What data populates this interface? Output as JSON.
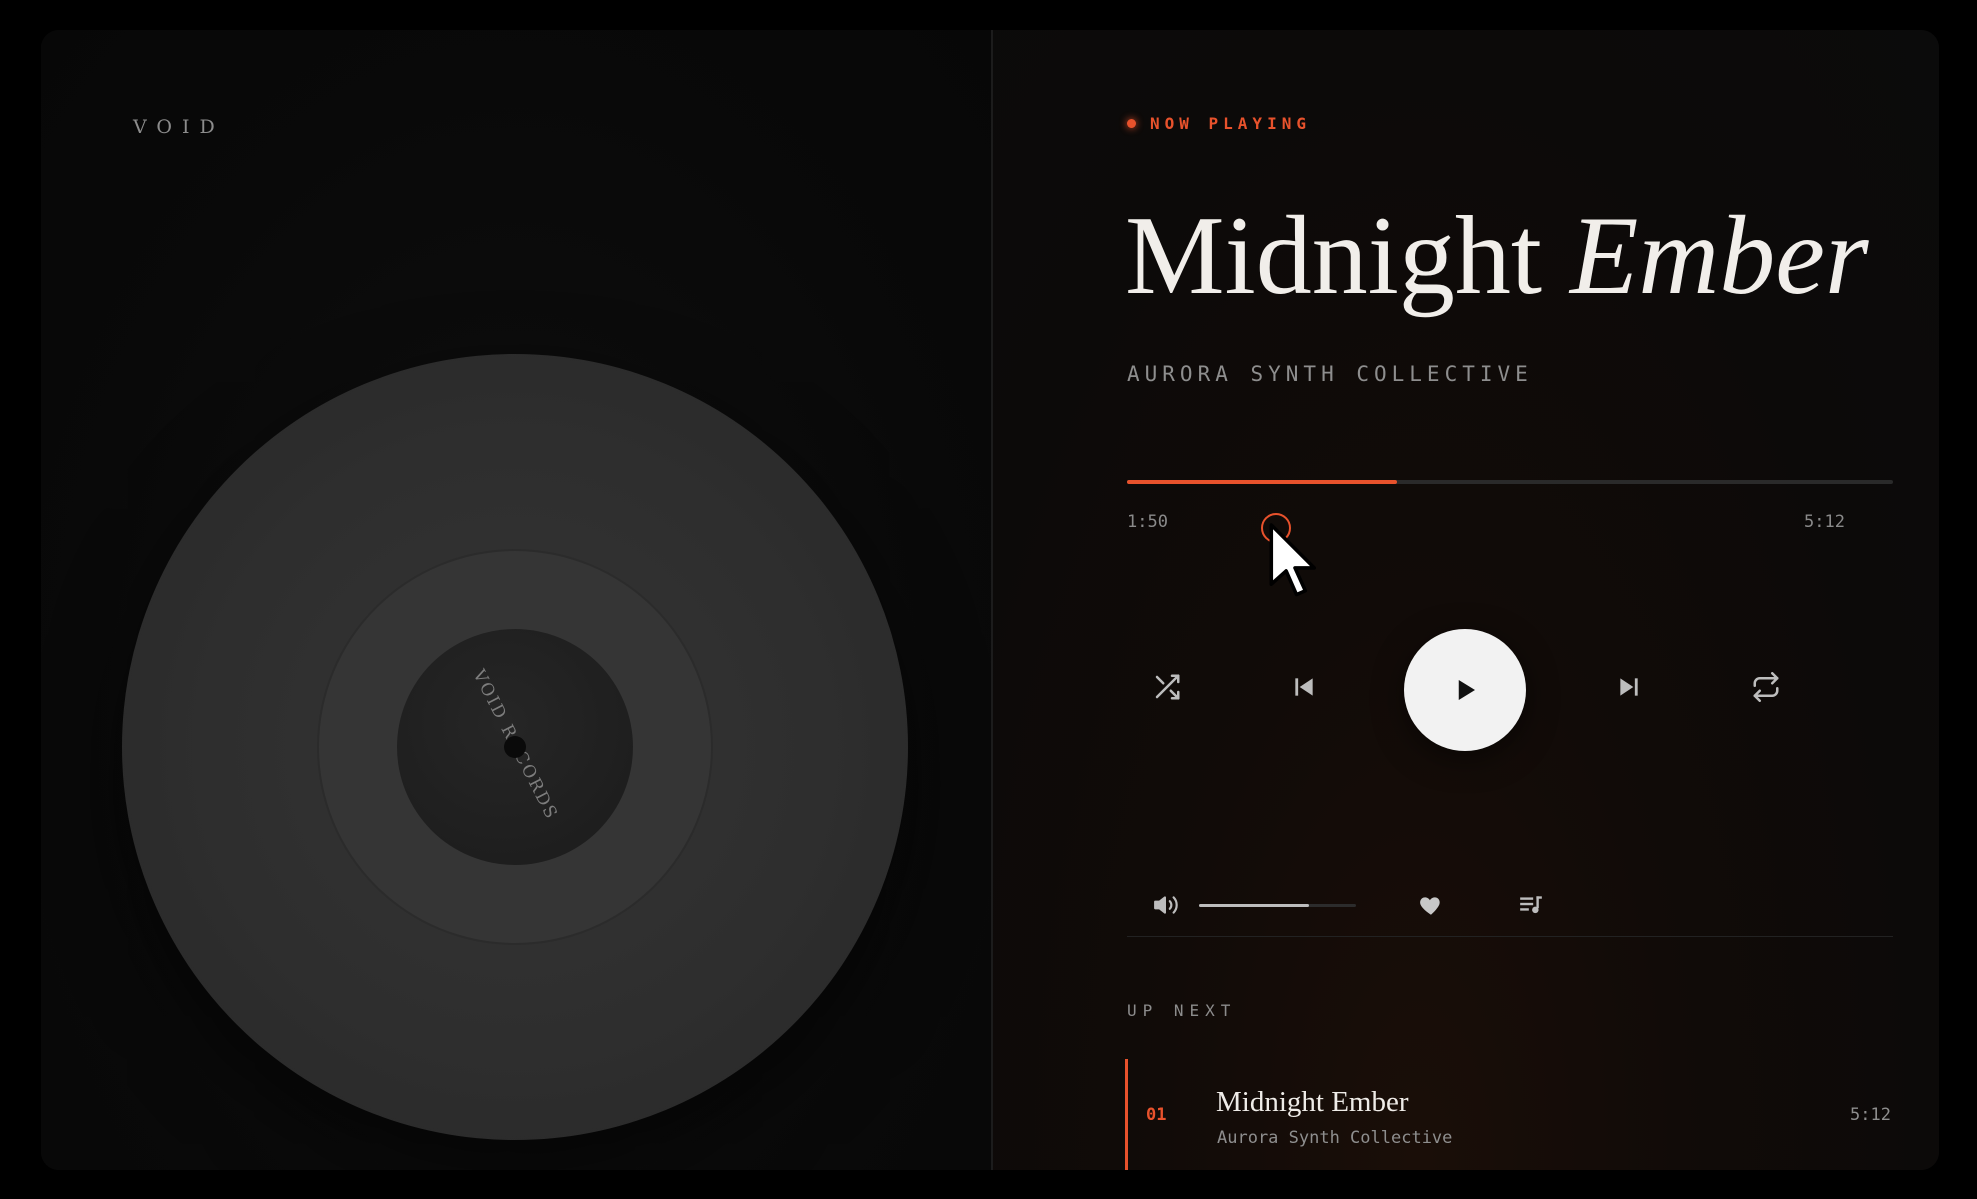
{
  "brand": {
    "name": "VOID"
  },
  "vinyl": {
    "label_text": "VOID RECORDS"
  },
  "now_playing": {
    "badge": "NOW PLAYING",
    "title_regular": "Midnight",
    "title_italic": "Ember",
    "artist": "AURORA SYNTH COLLECTIVE"
  },
  "progress": {
    "elapsed": "1:50",
    "total": "5:12",
    "fraction": 0.353
  },
  "controls": {
    "shuffle_icon": "shuffle-icon",
    "previous_icon": "skip-previous-icon",
    "play_icon": "play-icon",
    "next_icon": "skip-next-icon",
    "repeat_icon": "repeat-icon"
  },
  "volume": {
    "icon": "volume-icon",
    "level": 0.7
  },
  "actions": {
    "like_icon": "heart-icon",
    "queue_icon": "queue-music-icon"
  },
  "up_next": {
    "heading": "UP NEXT",
    "items": [
      {
        "index": "01",
        "title": "Midnight Ember",
        "artist": "Aurora Synth Collective",
        "duration": "5:12"
      }
    ]
  },
  "colors": {
    "accent": "#e8522c",
    "background": "#0b0b0b",
    "text_primary": "#f1eeea",
    "text_muted": "#8e8e8e"
  }
}
